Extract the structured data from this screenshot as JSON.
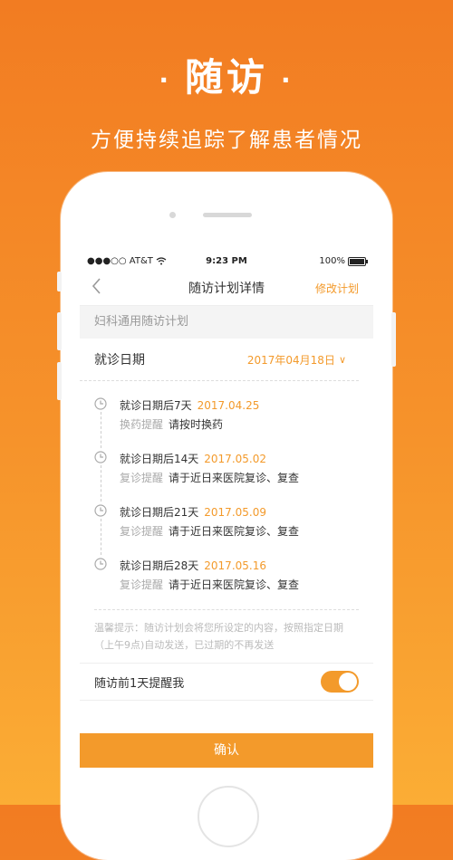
{
  "promo": {
    "title": "随访",
    "dot": "·",
    "subtitle": "方便持续追踪了解患者情况"
  },
  "status_bar": {
    "carrier": "●●●○○ AT&T",
    "time": "9:23 PM",
    "battery": "100%"
  },
  "nav": {
    "back_icon": "chevron-left-icon",
    "title": "随访计划详情",
    "edit_label": "修改计划"
  },
  "plan_name": "妇科通用随访计划",
  "visit_date": {
    "label": "就诊日期",
    "value": "2017年04月18日",
    "chevron": "∨"
  },
  "timeline": [
    {
      "title": "就诊日期后7天",
      "date": "2017.04.25",
      "tag": "换药提醒",
      "text": "请按时换药"
    },
    {
      "title": "就诊日期后14天",
      "date": "2017.05.02",
      "tag": "复诊提醒",
      "text": "请于近日来医院复诊、复查"
    },
    {
      "title": "就诊日期后21天",
      "date": "2017.05.09",
      "tag": "复诊提醒",
      "text": "请于近日来医院复诊、复查"
    },
    {
      "title": "就诊日期后28天",
      "date": "2017.05.16",
      "tag": "复诊提醒",
      "text": "请于近日来医院复诊、复查"
    }
  ],
  "tip": "温馨提示：随访计划会将您所设定的内容，按照指定日期（上午9点)自动发送，已过期的不再发送",
  "remind": {
    "label": "随访前1天提醒我",
    "enabled": true
  },
  "confirm_label": "确认",
  "colors": {
    "accent": "#f39a2b",
    "background_top": "#f27c22",
    "background_bottom": "#fbad35"
  }
}
